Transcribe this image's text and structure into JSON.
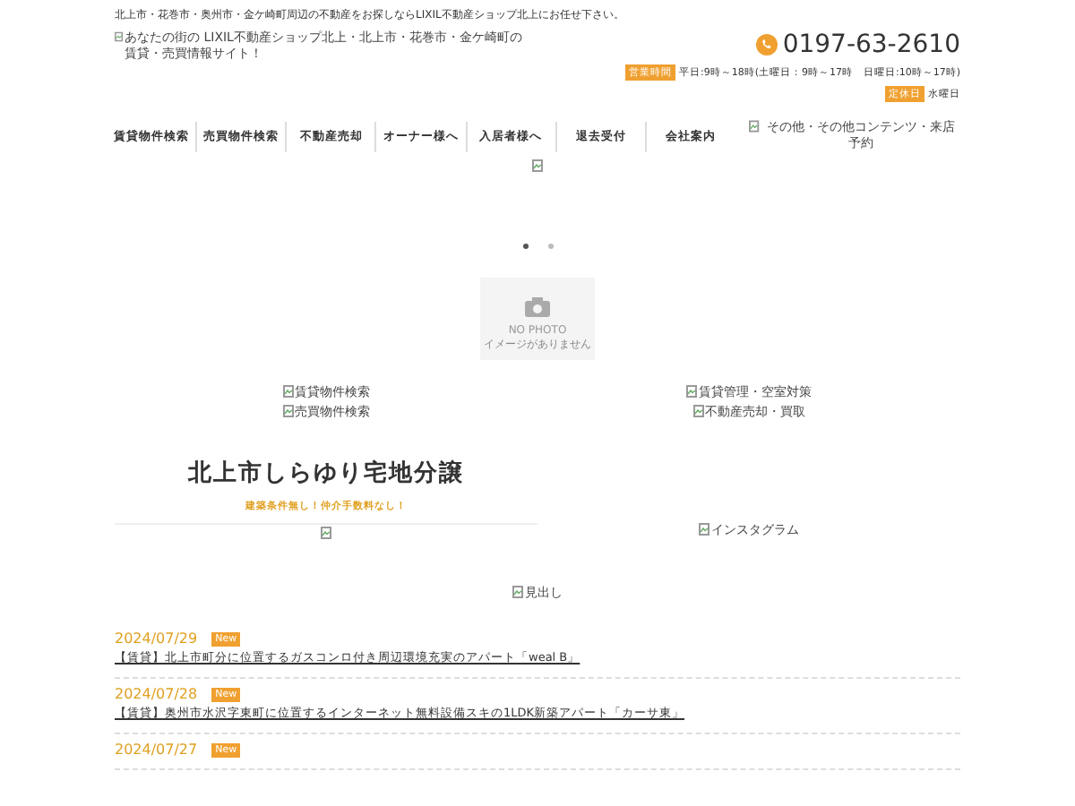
{
  "header": {
    "tagline": "北上市・花巻市・奥州市・金ケ崎町周辺の不動産をお探しならLIXIL不動産ショップ北上にお任せ下さい。",
    "logo_alt": "あなたの街の LIXIL不動産ショップ北上・北上市・花巻市・金ケ崎町の賃貸・売買情報サイト！",
    "phone": "0197-63-2610",
    "hours_label": "営業時間",
    "hours": "平日:9時～18時(土曜日：9時～17時　日曜日:10時～17時)",
    "closed_label": "定休日",
    "closed": "水曜日"
  },
  "nav": [
    "賃貸物件検索",
    "売買物件検索",
    "不動産売却",
    "オーナー様へ",
    "入居者様へ",
    "退去受付",
    "会社案内"
  ],
  "nav_banner_alt": "その他・その他コンテンツ・来店予約",
  "slider": {
    "dots": [
      {
        "selected": true
      },
      {
        "selected": false
      }
    ],
    "no_photo": "NO PHOTO",
    "no_photo_sub": "イメージがありません"
  },
  "links_left": [
    "賃貸物件検索",
    "売買物件検索"
  ],
  "links_right": [
    "賃貸管理・空室対策",
    "不動産売却・買取"
  ],
  "promo": {
    "title": "北上市しらゆり宅地分譲",
    "subtitle": "建築条件無し！仲介手数料なし！"
  },
  "instagram_alt": "インスタグラム",
  "heading_alt": "見出し",
  "news": [
    {
      "date": "2024/07/29",
      "badge": "New",
      "title": "【賃貸】北上市町分に位置するガスコンロ付き周辺環境充実のアパート「weal B」"
    },
    {
      "date": "2024/07/28",
      "badge": "New",
      "title": "【賃貸】奥州市水沢字東町に位置するインターネット無料設備スキの1LDK新築アパート「カーサ東」"
    },
    {
      "date": "2024/07/27",
      "badge": "New"
    }
  ]
}
